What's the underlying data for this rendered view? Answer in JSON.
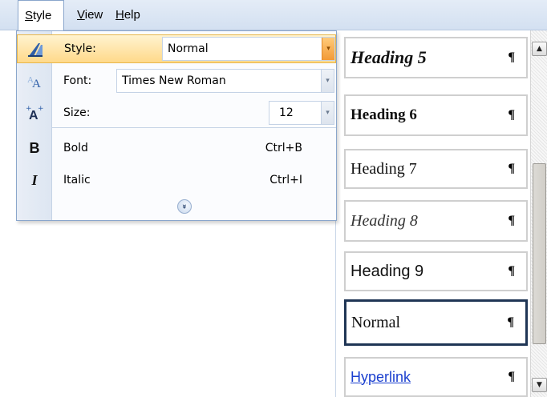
{
  "menubar": {
    "items": [
      {
        "label": "Style",
        "accel": "S",
        "rest": "tyle"
      },
      {
        "label": "View",
        "accel": "V",
        "rest": "iew"
      },
      {
        "label": "Help",
        "accel": "H",
        "rest": "elp"
      }
    ]
  },
  "dropdown": {
    "style_label": "Style:",
    "style_label_accel": "y",
    "style_value": "Normal",
    "font_label": "Font:",
    "font_label_accel": "F",
    "font_value": "Times New Roman",
    "size_label": "Size:",
    "size_value": "12",
    "bold_label": "Bold",
    "bold_label_accel": "B",
    "bold_shortcut": "Ctrl+B",
    "italic_label": "Italic",
    "italic_label_accel": "I",
    "italic_shortcut": "Ctrl+I",
    "icons": {
      "style": "paint-style-icon",
      "font": "font-icon",
      "size": "font-size-icon",
      "bold": "bold-icon",
      "italic": "italic-icon",
      "expand": "expand-chevron-icon"
    }
  },
  "gallery": {
    "pilcrow": "¶",
    "styles": [
      {
        "name": "Heading 5"
      },
      {
        "name": "Heading 6"
      },
      {
        "name": "Heading 7"
      },
      {
        "name": "Heading 8"
      },
      {
        "name": "Heading 9"
      },
      {
        "name": "Normal"
      },
      {
        "name": "Hyperlink"
      }
    ]
  },
  "colors": {
    "menubar_bg": "#d3e0f1",
    "highlight": "#ffd98a",
    "hyperlink": "#1a3fcf",
    "selected_border": "#1f3555"
  }
}
